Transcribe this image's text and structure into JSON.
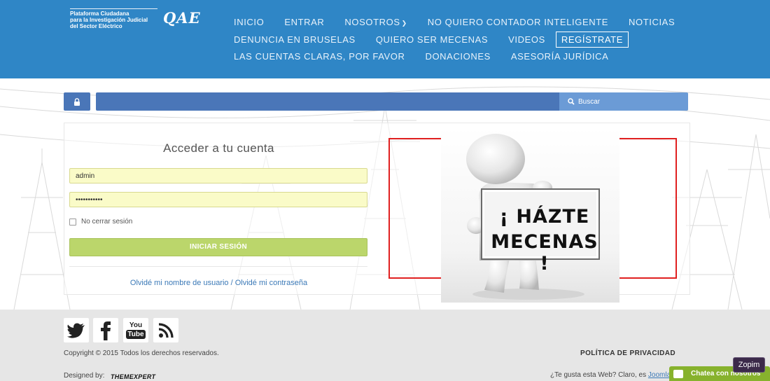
{
  "brand": {
    "line1": "Plataforma Ciudadana",
    "line2": "para la Investigación Judicial",
    "line3": "del Sector Eléctrico",
    "logo": "QAE"
  },
  "nav": {
    "row1": [
      "INICIO",
      "ENTRAR",
      "NOSOTROS",
      "NO QUIERO CONTADOR INTELIGENTE",
      "NOTICIAS"
    ],
    "row2": [
      "DENUNCIA EN BRUSELAS",
      "QUIERO SER MECENAS",
      "VIDEOS",
      "REGÍSTRATE"
    ],
    "row3": [
      "LAS CUENTAS CLARAS, POR FAVOR",
      "DONACIONES",
      "ASESORÍA JURÍDICA"
    ]
  },
  "toolbar": {
    "search_label": "Buscar",
    "lock_icon": "lock-icon",
    "search_icon": "magnifier-icon"
  },
  "login": {
    "title": "Acceder a tu cuenta",
    "username_value": "admin",
    "password_value": "•••••••••••",
    "remember_label": "No cerrar sesión",
    "submit_label": "INICIAR SESIÓN",
    "forgot_username": "Olvidé mi nombre de usuario",
    "separator": "/",
    "forgot_password": "Olvidé mi contraseña"
  },
  "banner": {
    "line1": "¡ HÁZTE",
    "line2": "MECENAS !"
  },
  "footer": {
    "social": [
      "twitter-icon",
      "facebook-icon",
      "youtube-icon",
      "rss-icon"
    ],
    "youtube_you": "You",
    "youtube_tube": "Tube",
    "copyright": "Copyright © 2015 Todos los derechos reservados.",
    "privacy": "POLÍTICA DE PRIVACIDAD",
    "designed_by": "Designed by:",
    "designer": "THEMEXPERT",
    "like_text": "¿Te gusta esta Web? Claro, es ",
    "like_link": "Joomla"
  },
  "chat": {
    "label": "Chatea con nosotros",
    "zopim": "Zopim"
  },
  "colors": {
    "header": "#2f86c6",
    "toolbar": "#4a76b8",
    "login_button": "#bbd66b",
    "autofill": "#fafbc8",
    "banner_frame": "#e02020",
    "chat": "#87b22d"
  }
}
